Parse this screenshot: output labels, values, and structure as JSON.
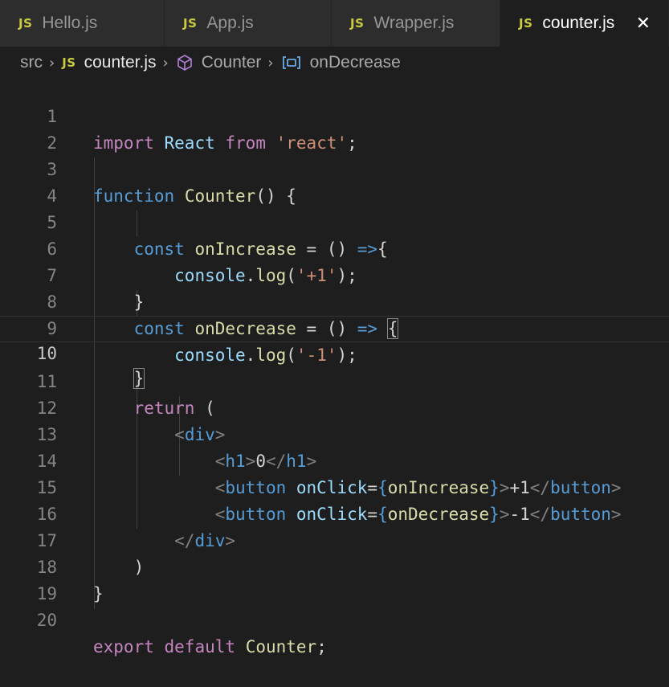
{
  "tabs": [
    {
      "badge": "JS",
      "label": "Hello.js"
    },
    {
      "badge": "JS",
      "label": "App.js"
    },
    {
      "badge": "JS",
      "label": "Wrapper.js"
    },
    {
      "badge": "JS",
      "label": "counter.js",
      "active": true,
      "close": "✕"
    }
  ],
  "breadcrumb": {
    "folder": "src",
    "file_badge": "JS",
    "file": "counter.js",
    "component": "Counter",
    "symbol": "onDecrease"
  },
  "editor": {
    "current_line": 10,
    "lines": [
      {
        "n": "1"
      },
      {
        "n": "2"
      },
      {
        "n": "3"
      },
      {
        "n": "4"
      },
      {
        "n": "5"
      },
      {
        "n": "6"
      },
      {
        "n": "7"
      },
      {
        "n": "8"
      },
      {
        "n": "9"
      },
      {
        "n": "10"
      },
      {
        "n": "11"
      },
      {
        "n": "12"
      },
      {
        "n": "13"
      },
      {
        "n": "14"
      },
      {
        "n": "15"
      },
      {
        "n": "16"
      },
      {
        "n": "17"
      },
      {
        "n": "18"
      },
      {
        "n": "19"
      },
      {
        "n": "20"
      }
    ],
    "tokens": {
      "l1": [
        "import",
        " ",
        "React",
        " ",
        "from",
        " ",
        "'react'",
        ";"
      ],
      "l3": [
        "function",
        " ",
        "Counter",
        "() {"
      ],
      "l5": [
        "    ",
        "const",
        " ",
        "onIncrease",
        " = () ",
        "=>",
        "{"
      ],
      "l6": [
        "        ",
        "console",
        ".",
        "log",
        "(",
        "'+1'",
        ");"
      ],
      "l7": [
        "    ",
        "}"
      ],
      "l8": [
        "    ",
        "const",
        " ",
        "onDecrease",
        " = () ",
        "=>",
        " ",
        "{"
      ],
      "l9": [
        "        ",
        "console",
        ".",
        "log",
        "(",
        "'-1'",
        ");"
      ],
      "l10": [
        "    ",
        "}"
      ],
      "l11": [
        "    ",
        "return",
        " ("
      ],
      "l12": [
        "        ",
        "<",
        "div",
        ">"
      ],
      "l13": [
        "            ",
        "<",
        "h1",
        ">",
        "0",
        "</",
        "h1",
        ">"
      ],
      "l14": [
        "            ",
        "<",
        "button",
        " ",
        "onClick",
        "=",
        "{",
        "onIncrease",
        "}",
        ">",
        "+1",
        "</",
        "button",
        ">"
      ],
      "l15": [
        "            ",
        "<",
        "button",
        " ",
        "onClick",
        "=",
        "{",
        "onDecrease",
        "}",
        ">",
        "-1",
        "</",
        "button",
        ">"
      ],
      "l16": [
        "        ",
        "</",
        "div",
        ">"
      ],
      "l17": [
        "    ",
        ")"
      ],
      "l18": [
        "}"
      ],
      "l20": [
        "export",
        " ",
        "default",
        " ",
        "Counter",
        ";"
      ]
    }
  }
}
